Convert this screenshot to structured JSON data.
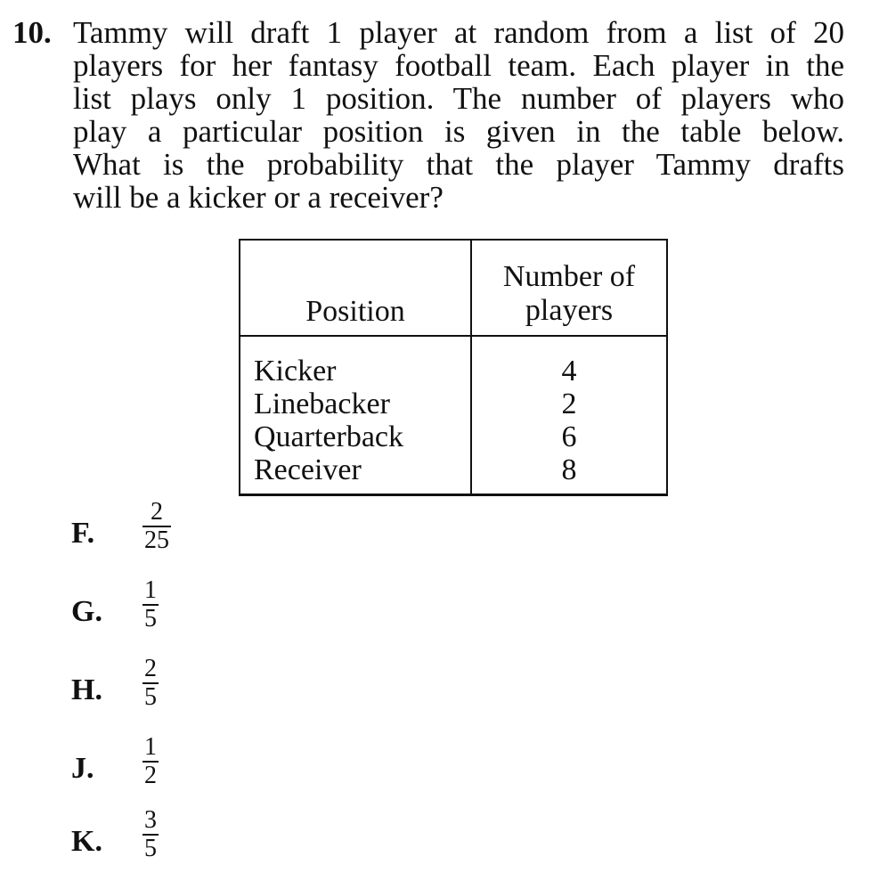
{
  "question": {
    "number": "10.",
    "lines": [
      "Tammy will draft 1 player at random from a list of 20",
      "players for her fantasy football team. Each player in the",
      "list plays only 1 position. The number of players who",
      "play a particular position is given in the table below.",
      "What is the probability that the player Tammy drafts",
      "will be a kicker or a receiver?"
    ]
  },
  "table": {
    "headers": {
      "position": "Position",
      "count_line1": "Number of",
      "count_line2": "players"
    },
    "rows": [
      {
        "position": "Kicker",
        "count": "4"
      },
      {
        "position": "Linebacker",
        "count": "2"
      },
      {
        "position": "Quarterback",
        "count": "6"
      },
      {
        "position": "Receiver",
        "count": "8"
      }
    ]
  },
  "choices": [
    {
      "letter": "F.",
      "numerator": "2",
      "denominator": "25"
    },
    {
      "letter": "G.",
      "numerator": "1",
      "denominator": "5"
    },
    {
      "letter": "H.",
      "numerator": "2",
      "denominator": "5"
    },
    {
      "letter": "J.",
      "numerator": "1",
      "denominator": "2"
    },
    {
      "letter": "K.",
      "numerator": "3",
      "denominator": "5"
    }
  ]
}
